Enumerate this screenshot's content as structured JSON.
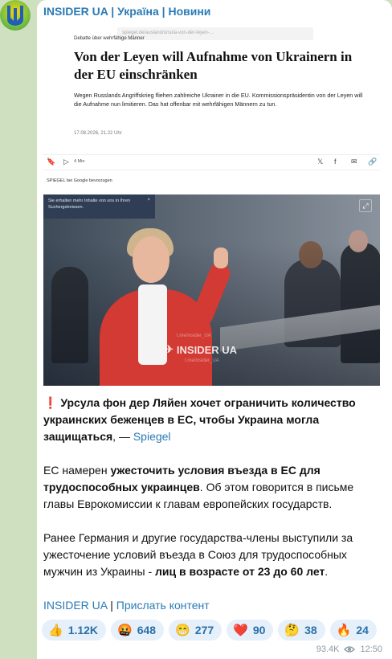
{
  "channel": {
    "title": "INSIDER UA | Україна | Новини"
  },
  "article": {
    "url_text": "spiegel.de/ausland/ursula-von-der-leyen-...",
    "kicker": "Debatte über wehrfähige Männer",
    "headline": "Von der Leyen will Aufnahme von Ukrainern in der EU einschränken",
    "lead": "Wegen Russlands Angriffskrieg fliehen zahlreiche Ukrainer in die EU. Kommissionspräsidentin von der Leyen will die Aufnahme nun limitieren. Das hat offenbar mit wehrfähigen Männern zu tun.",
    "dateline": "17.08.2026, 21.22 Uhr",
    "listen_time": "4 Min",
    "google_note": "SPIEGEL bei Google bevorzugen",
    "tooltip": "Sie erhalten mehr Inhalte von uns in Ihren Suchergebnissen.",
    "tooltip_close": "×",
    "watermark": "INSIDER UA",
    "watermark_channel": "t.me/insider_UA",
    "watermark_channel2": "t.me/insider_UA"
  },
  "message": {
    "p1_icon": "❗",
    "p1_bold": "Урсула фон дер Ляйен хочет ограничить количество украинских беженцев в ЕС, чтобы Украина могла защищаться",
    "p1_tail": ", — ",
    "p1_link": "Spiegel",
    "p2_a": "ЕС намерен ",
    "p2_bold": "ужесточить условия въезда в ЕС для трудоспособных украинцев",
    "p2_b": ". Об этом говорится в письме главы Еврокомиссии к главам европейских государств.",
    "p3_a": "Ранее Германия и другие государства-члены выступили за ужесточение условий въезда в Союз для трудоспособных мужчин из Украины - ",
    "p3_bold": "лиц в возрасте от 23 до 60 лет",
    "p3_b": ".",
    "footer_link1": "INSIDER UA",
    "footer_sep": " | ",
    "footer_link2": "Прислать контент"
  },
  "reactions": [
    {
      "emoji": "👍",
      "count": "1.12K"
    },
    {
      "emoji": "🤬",
      "count": "648"
    },
    {
      "emoji": "😁",
      "count": "277"
    },
    {
      "emoji": "❤️",
      "count": "90"
    },
    {
      "emoji": "🤔",
      "count": "38"
    },
    {
      "emoji": "🔥",
      "count": "24"
    }
  ],
  "meta": {
    "views": "93.4K",
    "time": "12:50"
  },
  "colors": {
    "accent": "#2a7ab4",
    "reaction_bg": "#e5f0fa",
    "chat_bg": "#cfe0c0",
    "jacket": "#d23a33"
  }
}
